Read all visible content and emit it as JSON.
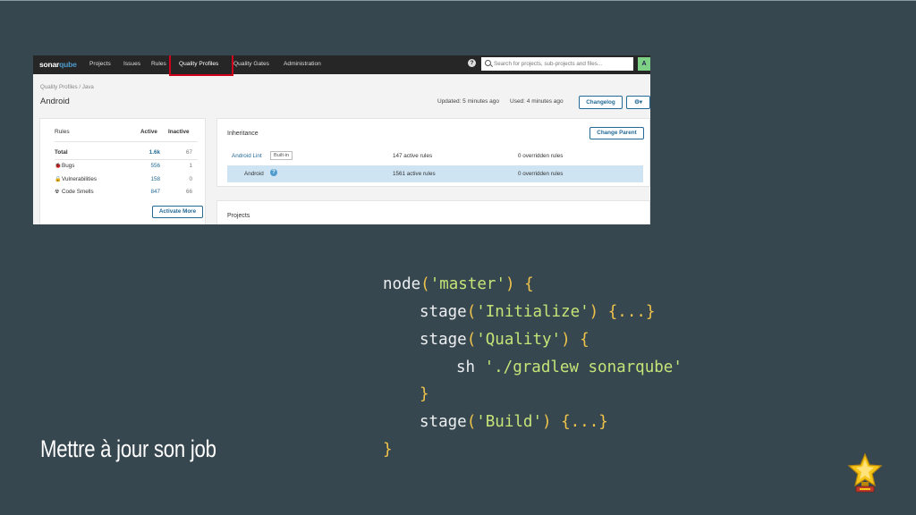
{
  "sonar": {
    "logo": {
      "prefix": "sonar",
      "accent": "qube"
    },
    "nav": [
      "Projects",
      "Issues",
      "Rules",
      "Quality Profiles",
      "Quality Gates",
      "Administration"
    ],
    "help": "?",
    "search_placeholder": "Search for projects, sub-projects and files...",
    "user_initial": "A",
    "breadcrumb": "Quality Profiles / Java",
    "title": "Android",
    "updated": "Updated: 5 minutes ago",
    "used": "Used: 4 minutes ago",
    "changelog": "Changelog",
    "gear": "⚙▾",
    "rules": {
      "heading": "Rules",
      "col_active": "Active",
      "col_inactive": "Inactive",
      "rows": [
        {
          "label": "Total",
          "active": "1.6k",
          "inactive": "67",
          "icon": ""
        },
        {
          "label": "Bugs",
          "active": "556",
          "inactive": "1",
          "icon": "bug-icon"
        },
        {
          "label": "Vulnerabilities",
          "active": "158",
          "inactive": "0",
          "icon": "lock-icon"
        },
        {
          "label": "Code Smells",
          "active": "847",
          "inactive": "66",
          "icon": "radiation-icon"
        }
      ],
      "activate_more": "Activate More"
    },
    "inheritance": {
      "heading": "Inheritance",
      "change_parent": "Change Parent",
      "rows": [
        {
          "name": "Android Lint",
          "tag": "Built-in",
          "active": "147 active rules",
          "overridden": "0 overridden rules"
        },
        {
          "name": "Android",
          "tag": "?",
          "active": "1561 active rules",
          "overridden": "0 overridden rules"
        }
      ]
    },
    "projects_heading": "Projects"
  },
  "code": {
    "l1": [
      "node",
      "(",
      "'master'",
      ")",
      " {"
    ],
    "l2": [
      "stage",
      "(",
      "'Initialize'",
      ")",
      " {...}"
    ],
    "l3": [
      "stage",
      "(",
      "'Quality'",
      ")",
      " {"
    ],
    "l4": [
      "sh ",
      "'./gradlew sonarqube'"
    ],
    "l5": "}",
    "l6": [
      "stage",
      "(",
      "'Build'",
      ")",
      " {...}"
    ],
    "l7": "}"
  },
  "caption": "Mettre à jour son job",
  "colors": {
    "background": "#37474f",
    "string": "#c5e478",
    "punct": "#f0c44a",
    "link": "#236a97",
    "highlight": "#d0021b"
  }
}
